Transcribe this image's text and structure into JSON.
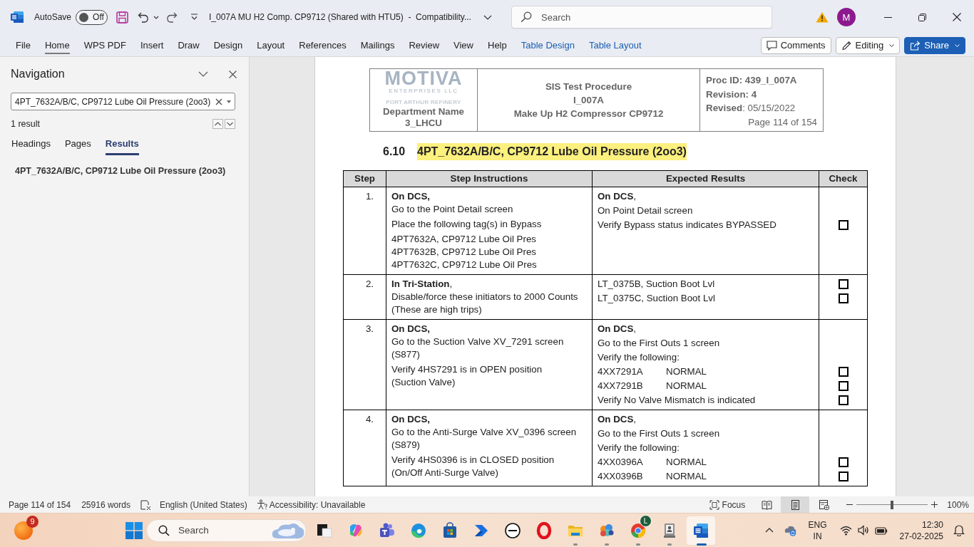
{
  "title_bar": {
    "autosave": {
      "label": "AutoSave",
      "on": false,
      "state_label": "Off"
    },
    "document_title": "I_007A MU H2 Comp. CP9712 (Shared with HTU5)  -  Compatibility...",
    "search": {
      "placeholder": "Search"
    },
    "account": {
      "initial": "M"
    }
  },
  "ribbon": {
    "tabs": [
      {
        "label": "File",
        "selected": false,
        "kind": "standard"
      },
      {
        "label": "Home",
        "selected": true,
        "kind": "standard"
      },
      {
        "label": "WPS PDF",
        "selected": false,
        "kind": "standard"
      },
      {
        "label": "Insert",
        "selected": false,
        "kind": "standard"
      },
      {
        "label": "Draw",
        "selected": false,
        "kind": "standard"
      },
      {
        "label": "Design",
        "selected": false,
        "kind": "standard"
      },
      {
        "label": "Layout",
        "selected": false,
        "kind": "standard"
      },
      {
        "label": "References",
        "selected": false,
        "kind": "standard"
      },
      {
        "label": "Mailings",
        "selected": false,
        "kind": "standard"
      },
      {
        "label": "Review",
        "selected": false,
        "kind": "standard"
      },
      {
        "label": "View",
        "selected": false,
        "kind": "standard"
      },
      {
        "label": "Help",
        "selected": false,
        "kind": "standard"
      },
      {
        "label": "Table Design",
        "selected": false,
        "kind": "contextual"
      },
      {
        "label": "Table Layout",
        "selected": false,
        "kind": "contextual"
      }
    ],
    "comments_button": "Comments",
    "mode_button": "Editing",
    "share_button": "Share"
  },
  "navigation": {
    "title": "Navigation",
    "search": {
      "value": "4PT_7632A/B/C, CP9712 Lube Oil Pressure (2oo3)"
    },
    "result_count": "1 result",
    "tabs": [
      {
        "label": "Headings",
        "selected": false
      },
      {
        "label": "Pages",
        "selected": false
      },
      {
        "label": "Results",
        "selected": true
      }
    ],
    "results": [
      "4PT_7632A/B/C, CP9712 Lube Oil Pressure (2oo3)"
    ]
  },
  "document": {
    "header": {
      "logo": {
        "name": "MOTIVA",
        "tagline": "ENTERPRISES LLC"
      },
      "site": "PORT ARTHUR REFINERY",
      "department": "Department Name",
      "unit": "3_LHCU",
      "procedure": [
        "SIS Test Procedure",
        "I_007A",
        "Make Up H2 Compressor CP9712"
      ],
      "details": [
        {
          "kind": "bold",
          "text": "Proc ID: 439_I_007A"
        },
        {
          "kind": "bold",
          "text": "Revision: 4"
        },
        {
          "kind": "plain",
          "text": "**Revised**: 05/15/2022"
        },
        {
          "kind": "page",
          "text": "Page 114 of 154"
        }
      ]
    },
    "section": {
      "number": "6.10",
      "title": "4PT_7632A/B/C, CP9712 Lube Oil Pressure (2oo3)",
      "highlighted": true
    },
    "table": {
      "columns": [
        "Step",
        "Step Instructions",
        "Expected Results",
        "Check"
      ],
      "rows": [
        {
          "step": "1.",
          "instructions": [
            [
              {
                "kind": "bold",
                "text": "On DCS,"
              },
              {
                "kind": "plain",
                "text": "Go to the Point Detail screen"
              }
            ],
            [
              {
                "kind": "plain",
                "text": "Place the following tag(s) in Bypass"
              }
            ],
            [
              {
                "kind": "plain",
                "text": "4PT7632A, CP9712 Lube Oil Pres"
              },
              {
                "kind": "plain",
                "text": "4PT7632B, CP9712 Lube Oil Pres"
              },
              {
                "kind": "plain",
                "text": "4PT7632C, CP9712 Lube Oil Pres"
              }
            ]
          ],
          "expected": [
            {
              "kind": "plain",
              "text": "**On DCS**,"
            },
            {
              "kind": "plain",
              "text": "On Point Detail screen"
            },
            {
              "kind": "plain",
              "text": "Verify Bypass status indicates BYPASSED",
              "checkbox": {
                "checked": false
              }
            }
          ]
        },
        {
          "step": "2.",
          "instructions": [
            [
              {
                "kind": "plain",
                "text": "**In Tri-Station**,"
              },
              {
                "kind": "plain",
                "text": "Disable/force these initiators to 2000 Counts (These are high trips)"
              }
            ]
          ],
          "expected": [
            {
              "kind": "plain",
              "text": "LT_0375B, Suction Boot Lvl",
              "checkbox": {
                "checked": false
              }
            },
            {
              "kind": "plain",
              "text": "LT_0375C, Suction Boot Lvl",
              "checkbox": {
                "checked": false
              }
            }
          ]
        },
        {
          "step": "3.",
          "instructions": [
            [
              {
                "kind": "bold",
                "text": "On DCS,"
              },
              {
                "kind": "plain",
                "text": "Go to the Suction Valve XV_7291 screen (S877)"
              }
            ],
            [
              {
                "kind": "plain",
                "text": "Verify 4HS7291 is in OPEN position\n(Suction Valve)"
              }
            ]
          ],
          "expected": [
            {
              "kind": "plain",
              "text": "**On DCS**,"
            },
            {
              "kind": "plain",
              "text": "Go to the First Outs 1 screen"
            },
            {
              "kind": "plain",
              "text": "Verify the following:"
            },
            {
              "kind": "pair",
              "tag": "4XX7291A",
              "status": "NORMAL",
              "checkbox": {
                "checked": false
              }
            },
            {
              "kind": "pair",
              "tag": "4XX7291B",
              "status": "NORMAL",
              "checkbox": {
                "checked": false
              }
            },
            {
              "kind": "plain",
              "text": "Verify No Valve Mismatch is indicated",
              "checkbox": {
                "checked": false
              }
            }
          ]
        },
        {
          "step": "4.",
          "instructions": [
            [
              {
                "kind": "bold",
                "text": "On DCS,"
              },
              {
                "kind": "plain",
                "text": "Go to the Anti-Surge Valve XV_0396 screen (S879)"
              }
            ],
            [
              {
                "kind": "plain",
                "text": "Verify 4HS0396 is in CLOSED position\n(On/Off Anti-Surge Valve)"
              }
            ]
          ],
          "expected": [
            {
              "kind": "plain",
              "text": "**On DCS**,"
            },
            {
              "kind": "plain",
              "text": "Go to the First Outs 1 screen"
            },
            {
              "kind": "plain",
              "text": "Verify the following:"
            },
            {
              "kind": "pair",
              "tag": "4XX0396A",
              "status": "NORMAL",
              "checkbox": {
                "checked": false
              }
            },
            {
              "kind": "pair",
              "tag": "4XX0396B",
              "status": "NORMAL",
              "checkbox": {
                "checked": false
              }
            }
          ]
        }
      ]
    }
  },
  "status_bar": {
    "page": "Page 114 of 154",
    "words": "25916 words",
    "language": "English (United States)",
    "accessibility": "Accessibility: Unavailable",
    "focus": "Focus",
    "views": [
      {
        "kind": "read",
        "selected": false
      },
      {
        "kind": "print",
        "selected": true
      },
      {
        "kind": "web",
        "selected": false
      }
    ],
    "zoom": {
      "level": 0.5,
      "reading": "100%"
    }
  },
  "taskbar": {
    "widget": {
      "badge": "9"
    },
    "search": {
      "placeholder": "Search"
    },
    "apps": [
      {
        "kind": "squares",
        "running": false,
        "active": false
      },
      {
        "kind": "swirl",
        "running": false,
        "active": false
      },
      {
        "kind": "people",
        "running": false,
        "active": false
      },
      {
        "kind": "wave",
        "running": false,
        "active": false
      },
      {
        "kind": "bag",
        "running": false,
        "active": false
      },
      {
        "kind": "arrow",
        "running": false,
        "active": false
      },
      {
        "kind": "circle",
        "running": false,
        "active": false
      },
      {
        "kind": "ring",
        "running": false,
        "active": false
      },
      {
        "kind": "folder",
        "running": true,
        "active": false
      },
      {
        "kind": "blobs",
        "running": true,
        "active": false
      },
      {
        "kind": "ball",
        "running": true,
        "active": false,
        "badge": "L"
      },
      {
        "kind": "portrait",
        "running": true,
        "active": false
      },
      {
        "kind": "document",
        "running": true,
        "active": true
      }
    ],
    "tray": {
      "language": [
        "ENG",
        "IN"
      ],
      "time": "12:30",
      "date": "27-02-2025"
    }
  }
}
